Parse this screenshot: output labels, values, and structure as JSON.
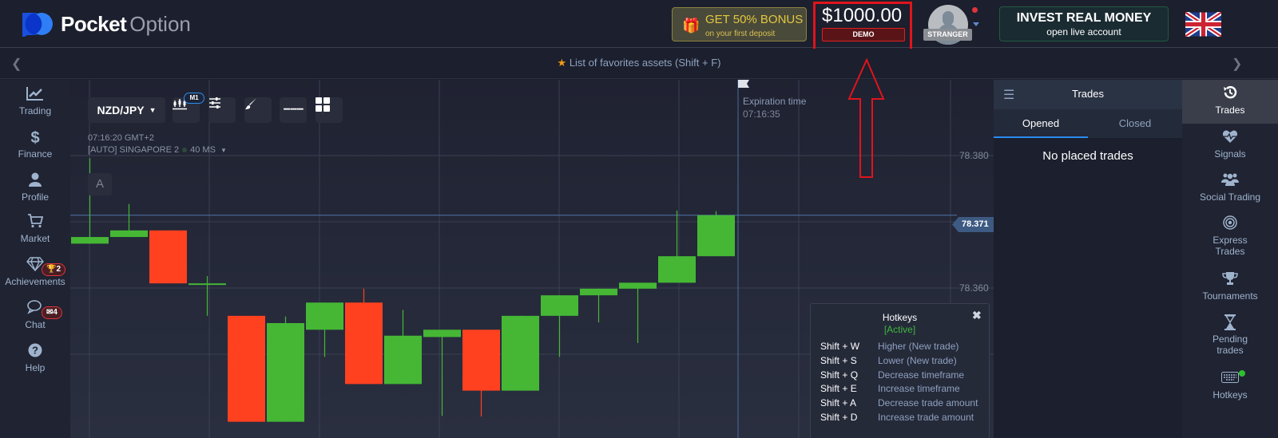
{
  "header": {
    "logo_bold": "Pocket",
    "logo_light": "Option",
    "bonus": {
      "line1": "GET 50% BONUS",
      "line2": "on your first deposit",
      "icon": "gift-icon"
    },
    "balance": "$1000.00",
    "account_type": "DEMO",
    "user_label": "STRANGER",
    "invest": {
      "line1": "INVEST REAL MONEY",
      "line2": "open live account"
    },
    "language": "English (UK flag)"
  },
  "favorites_bar": {
    "text": "List of favorites assets (Shift + F)",
    "icon": "star-icon"
  },
  "left_nav": [
    {
      "label": "Trading",
      "icon": "chart-line-icon"
    },
    {
      "label": "Finance",
      "icon": "dollar-icon"
    },
    {
      "label": "Profile",
      "icon": "user-icon"
    },
    {
      "label": "Market",
      "icon": "cart-icon"
    },
    {
      "label": "Achievements",
      "icon": "diamond-icon",
      "badge": "2"
    },
    {
      "label": "Chat",
      "icon": "chat-icon",
      "badge": "4"
    },
    {
      "label": "Help",
      "icon": "help-icon"
    }
  ],
  "chart_toolbar": {
    "asset": "NZD/JPY",
    "timeframe_badge": "M1",
    "server_time": "07:16:20 GMT+2",
    "server": "[AUTO] SINGAPORE 2",
    "ping": "40 MS",
    "a_button": "A"
  },
  "expiration": {
    "label": "Expiration time",
    "time": "07:16:35"
  },
  "chart_data": {
    "type": "candlestick",
    "title": "NZD/JPY M1",
    "y_ticks": [
      "78.380",
      "78.360"
    ],
    "current_price": "78.371",
    "ylim": [
      78.3385,
      78.381
    ],
    "candles": [
      {
        "o": 78.3667,
        "h": 78.3796,
        "l": 78.3667,
        "c": 78.3677
      },
      {
        "o": 78.3677,
        "h": 78.3727,
        "l": 78.3677,
        "c": 78.3687
      },
      {
        "o": 78.3687,
        "h": 78.3687,
        "l": 78.3607,
        "c": 78.3607
      },
      {
        "o": 78.3607,
        "h": 78.3618,
        "l": 78.3558,
        "c": 78.3607
      },
      {
        "o": 78.3558,
        "h": 78.3558,
        "l": 78.3398,
        "c": 78.3398
      },
      {
        "o": 78.3398,
        "h": 78.3557,
        "l": 78.3398,
        "c": 78.3547
      },
      {
        "o": 78.3537,
        "h": 78.3578,
        "l": 78.3496,
        "c": 78.3578
      },
      {
        "o": 78.3578,
        "h": 78.3599,
        "l": 78.3455,
        "c": 78.3455
      },
      {
        "o": 78.3455,
        "h": 78.3567,
        "l": 78.3455,
        "c": 78.3528
      },
      {
        "o": 78.3526,
        "h": 78.3537,
        "l": 78.3407,
        "c": 78.3537
      },
      {
        "o": 78.3537,
        "h": 78.3537,
        "l": 78.3406,
        "c": 78.3445
      },
      {
        "o": 78.3445,
        "h": 78.3558,
        "l": 78.3445,
        "c": 78.3558
      },
      {
        "o": 78.3558,
        "h": 78.3589,
        "l": 78.3496,
        "c": 78.3589
      },
      {
        "o": 78.3589,
        "h": 78.3599,
        "l": 78.3548,
        "c": 78.3599
      },
      {
        "o": 78.3599,
        "h": 78.3608,
        "l": 78.3517,
        "c": 78.3608
      },
      {
        "o": 78.3608,
        "h": 78.3717,
        "l": 78.3608,
        "c": 78.3648
      },
      {
        "o": 78.3648,
        "h": 78.3716,
        "l": 78.3648,
        "c": 78.371
      }
    ],
    "colors": {
      "up": "#45b735",
      "down": "#ff4120"
    }
  },
  "hotkeys": {
    "title": "Hotkeys",
    "status": "[Active]",
    "rows": [
      {
        "key": "Shift + W",
        "desc": "Higher (New trade)"
      },
      {
        "key": "Shift + S",
        "desc": "Lower (New trade)"
      },
      {
        "key": "Shift + Q",
        "desc": "Decrease timeframe"
      },
      {
        "key": "Shift + E",
        "desc": "Increase timeframe"
      },
      {
        "key": "Shift + A",
        "desc": "Decrease trade amount"
      },
      {
        "key": "Shift + D",
        "desc": "Increase trade amount"
      }
    ]
  },
  "trades_panel": {
    "title": "Trades",
    "tabs": [
      "Opened",
      "Closed"
    ],
    "empty": "No placed trades"
  },
  "right_nav": [
    {
      "label": "Trades",
      "icon": "history-icon",
      "active": true
    },
    {
      "label": "Signals",
      "icon": "heart-pulse-icon"
    },
    {
      "label": "Social Trading",
      "icon": "users-icon"
    },
    {
      "label": "Express Trades",
      "icon": "target-icon"
    },
    {
      "label": "Tournaments",
      "icon": "trophy-icon"
    },
    {
      "label": "Pending trades",
      "icon": "hourglass-icon"
    },
    {
      "label": "Hotkeys",
      "icon": "keyboard-icon"
    }
  ]
}
